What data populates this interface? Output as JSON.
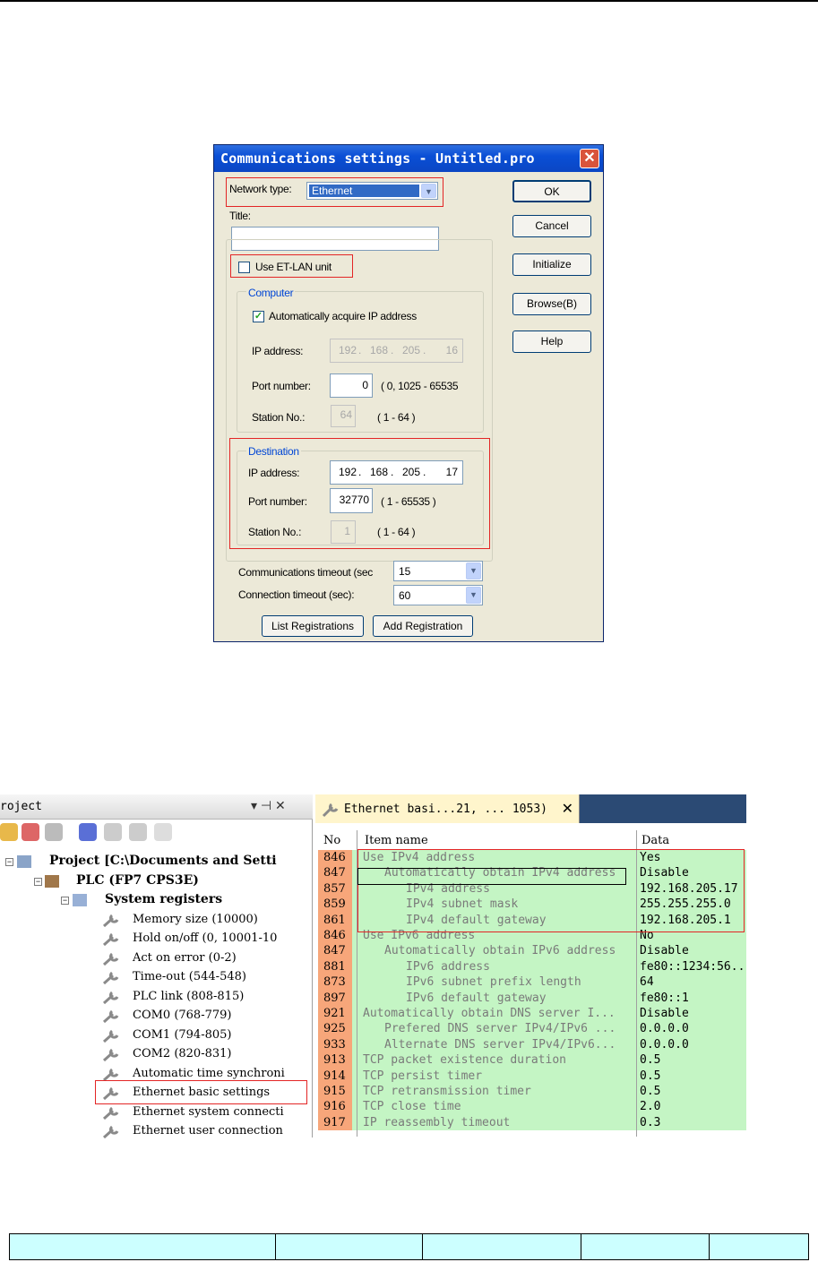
{
  "dialog": {
    "title": "Communications settings - Untitled.pro",
    "close_glyph": "✕",
    "network_type_label": "Network type:",
    "network_type_value": "Ethernet",
    "title_label": "Title:",
    "title_value": "",
    "use_etlan_label": "Use ET-LAN unit",
    "computer": {
      "group_label": "Computer",
      "auto_ip_label": "Automatically acquire IP address",
      "ip_label": "IP address:",
      "ip": [
        "192",
        "168",
        "205",
        "16"
      ],
      "port_label": "Port number:",
      "port_value": "0",
      "port_range": "( 0, 1025 - 65535",
      "station_label": "Station No.:",
      "station_value": "64",
      "station_range": "( 1 - 64 )"
    },
    "destination": {
      "group_label": "Destination",
      "ip_label": "IP address:",
      "ip": [
        "192",
        "168",
        "205",
        "17"
      ],
      "port_label": "Port number:",
      "port_value": "32770",
      "port_range": "( 1 - 65535 )",
      "station_label": "Station No.:",
      "station_value": "1",
      "station_range": "( 1 - 64 )"
    },
    "comm_timeout_label": "Communications timeout (sec",
    "comm_timeout_value": "15",
    "conn_timeout_label": "Connection timeout (sec):",
    "conn_timeout_value": "60",
    "buttons": {
      "ok": "OK",
      "cancel": "Cancel",
      "initialize": "Initialize",
      "browse": "Browse(B)",
      "help": "Help",
      "list_registrations": "List Registrations",
      "add_registration": "Add Registration"
    }
  },
  "project_panel": {
    "title": "roject",
    "pin_glyph": "▾ ⊣ ✕",
    "tree": [
      {
        "label": "Project [C:\\Documents and Setti"
      },
      {
        "label": "PLC (FP7 CPS3E)"
      },
      {
        "label": "System registers"
      },
      {
        "label": "Memory size (10000)"
      },
      {
        "label": "Hold on/off (0, 10001-10"
      },
      {
        "label": "Act on error (0-2)"
      },
      {
        "label": "Time-out (544-548)"
      },
      {
        "label": "PLC link (808-815)"
      },
      {
        "label": "COM0 (768-779)"
      },
      {
        "label": "COM1 (794-805)"
      },
      {
        "label": "COM2 (820-831)"
      },
      {
        "label": "Automatic time synchroni"
      },
      {
        "label": "Ethernet basic settings"
      },
      {
        "label": "Ethernet system connecti"
      },
      {
        "label": "Ethernet user connection"
      }
    ]
  },
  "ethernet_panel": {
    "tab_label": "Ethernet basi...21, ... 1053)",
    "tab_close": "✕",
    "headers": {
      "no": "No",
      "item": "Item name",
      "data": "Data"
    },
    "rows": [
      {
        "no": "846",
        "name": "Use IPv4 address",
        "indent": 0,
        "data": "Yes"
      },
      {
        "no": "847",
        "name": "Automatically obtain IPv4 address",
        "indent": 1,
        "data": "Disable"
      },
      {
        "no": "857",
        "name": "IPv4 address",
        "indent": 2,
        "data": "192.168.205.17"
      },
      {
        "no": "859",
        "name": "IPv4 subnet mask",
        "indent": 2,
        "data": "255.255.255.0"
      },
      {
        "no": "861",
        "name": "IPv4 default gateway",
        "indent": 2,
        "data": "192.168.205.1"
      },
      {
        "no": "846",
        "name": "Use IPv6 address",
        "indent": 0,
        "data": "No"
      },
      {
        "no": "847",
        "name": "Automatically obtain IPv6 address",
        "indent": 1,
        "data": "Disable"
      },
      {
        "no": "881",
        "name": "IPv6 address",
        "indent": 2,
        "data": "fe80::1234:56.."
      },
      {
        "no": "873",
        "name": "IPv6 subnet prefix length",
        "indent": 2,
        "data": "64"
      },
      {
        "no": "897",
        "name": "IPv6 default gateway",
        "indent": 2,
        "data": "fe80::1"
      },
      {
        "no": "921",
        "name": "Automatically obtain DNS server I...",
        "indent": 0,
        "data": "Disable"
      },
      {
        "no": "925",
        "name": "Prefered DNS server IPv4/IPv6 ...",
        "indent": 1,
        "data": "0.0.0.0"
      },
      {
        "no": "933",
        "name": "Alternate DNS server IPv4/IPv6...",
        "indent": 1,
        "data": "0.0.0.0"
      },
      {
        "no": "913",
        "name": "TCP packet existence duration",
        "indent": 0,
        "data": "0.5"
      },
      {
        "no": "914",
        "name": "TCP persist timer",
        "indent": 0,
        "data": "0.5"
      },
      {
        "no": "915",
        "name": "TCP retransmission timer",
        "indent": 0,
        "data": "0.5"
      },
      {
        "no": "916",
        "name": "TCP close time",
        "indent": 0,
        "data": "2.0"
      },
      {
        "no": "917",
        "name": "IP reassembly timeout",
        "indent": 0,
        "data": "0.3"
      }
    ]
  },
  "colors": {
    "highlight_red": "#e32525",
    "row_green": "#c4f5c4",
    "no_orange": "#f7a67a",
    "title_blue": "#0a4fd6",
    "table_cyan": "#ccffff"
  }
}
